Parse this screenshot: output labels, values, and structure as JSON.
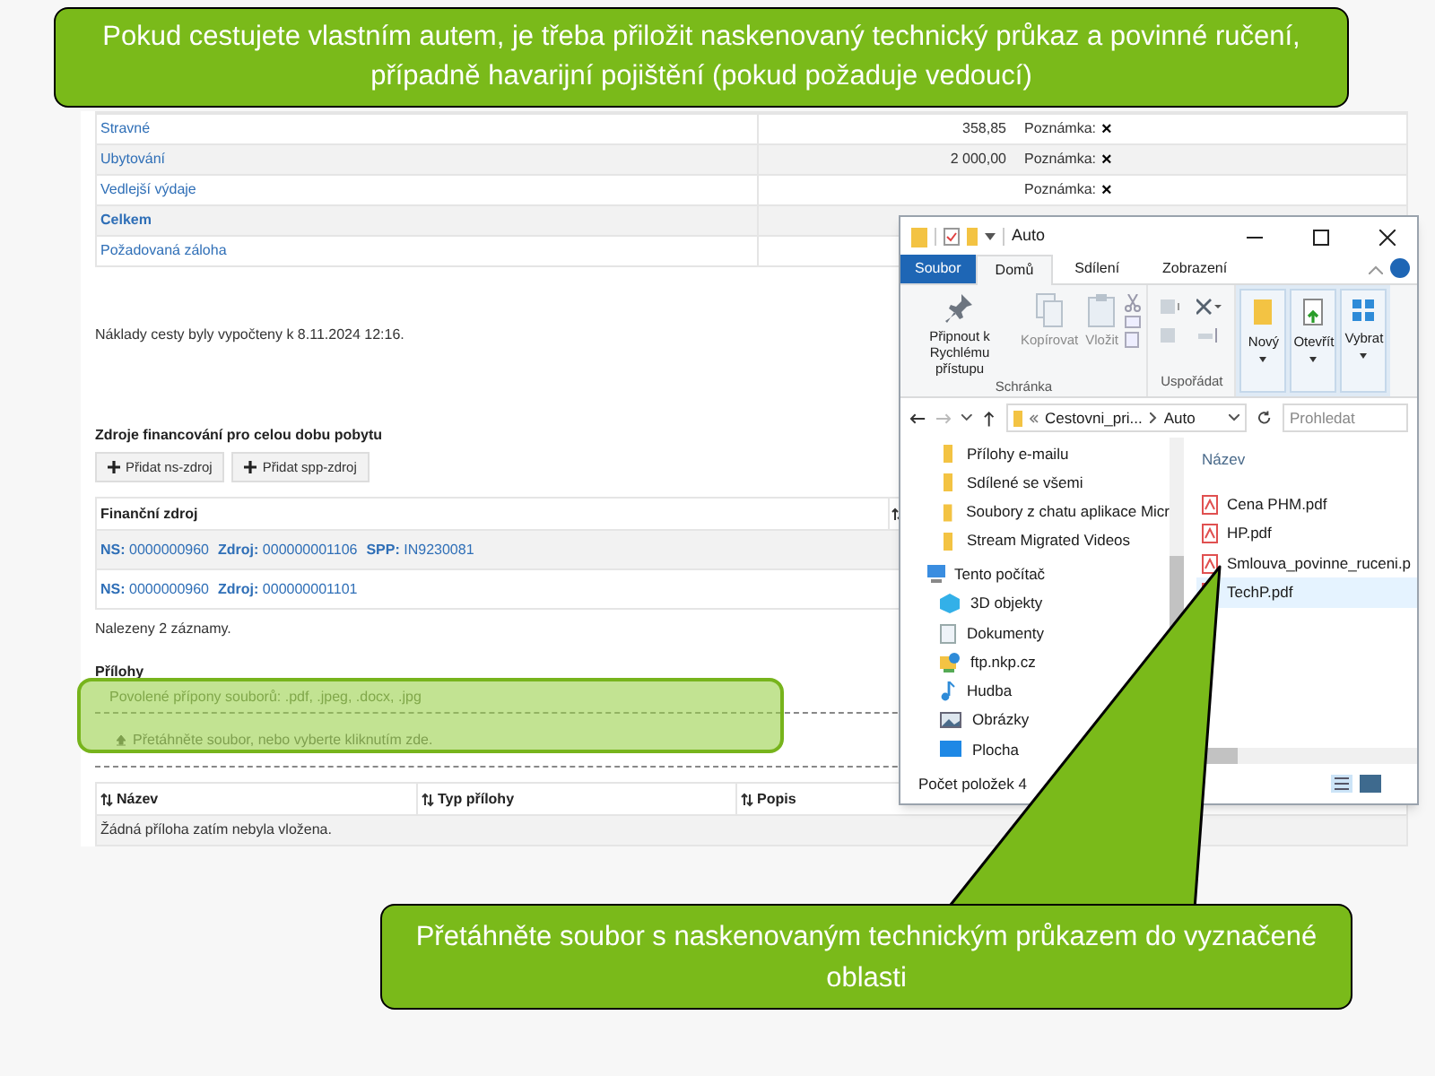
{
  "callout_top": {
    "text": "Pokud cestujete vlastním autem, je třeba přiložit naskenovaný technický průkaz a povinné ručení, případně havarijní pojištění (pokud požaduje vedoucí)"
  },
  "callout_bottom": {
    "text": "Přetáhněte soubor s naskenovaným technickým průkazem do vyznačené oblasti"
  },
  "costs": [
    {
      "label": "Stravné",
      "value": "358,85",
      "note": "Poznámka:",
      "mark": "×",
      "bold": false
    },
    {
      "label": "Ubytování",
      "value": "2 000,00",
      "note": "Poznámka:",
      "mark": "×",
      "bold": false
    },
    {
      "label": "Vedlejší výdaje",
      "note": "Poznámka:",
      "mark": "×",
      "bold": false
    },
    {
      "label": "Celkem",
      "bold": true
    },
    {
      "label": "Požadovaná záloha",
      "bold": false
    }
  ],
  "calc_note": "Náklady cesty byly vypočteny k 8.11.2024 12:16.",
  "financing": {
    "title": "Zdroje financování pro celou dobu pobytu",
    "buttons": [
      "Přidat ns-zdroj",
      "Přidat spp-zdroj"
    ],
    "column": "Finanční zdroj",
    "rows": [
      [
        {
          "label": "NS:",
          "value": "0000000960"
        },
        {
          "label": "Zdroj:",
          "value": "000000001106"
        },
        {
          "label": "SPP:",
          "value": "IN9230081"
        }
      ],
      [
        {
          "label": "NS:",
          "value": "0000000960"
        },
        {
          "label": "Zdroj:",
          "value": "000000001101"
        }
      ]
    ],
    "count": "Nalezeny 2 záznamy."
  },
  "attachments": {
    "title": "Přílohy",
    "allowed": "Povolené přípony souborů: .pdf, .jpeg, .docx, .jpg",
    "dropzone": "Přetáhněte soubor, nebo vyberte kliknutím zde.",
    "columns": [
      "Název",
      "Typ přílohy",
      "Popis"
    ],
    "empty": "Žádná příloha zatím nebyla vložena."
  },
  "explorer": {
    "title": "Auto",
    "tabs": [
      {
        "label": "Soubor",
        "kind": "file",
        "selected": false
      },
      {
        "label": "Domů",
        "kind": "tab",
        "selected": true
      },
      {
        "label": "Sdílení",
        "kind": "tab",
        "selected": false
      },
      {
        "label": "Zobrazení",
        "kind": "tab",
        "selected": false
      }
    ],
    "groups": [
      {
        "label": "Schránka",
        "commands": [
          {
            "label": "Připnout k Rychlému přístupu",
            "kind": "pin",
            "disabled": false
          },
          {
            "label": "Kopírovat",
            "kind": "copy",
            "disabled": true
          },
          {
            "label": "Vložit",
            "kind": "paste",
            "disabled": true
          }
        ]
      },
      {
        "label": "Uspořádat"
      }
    ],
    "big_commands": [
      {
        "label": "Nový",
        "kind": "new"
      },
      {
        "label": "Otevřít",
        "kind": "open"
      },
      {
        "label": "Vybrat",
        "kind": "select"
      }
    ],
    "path": [
      "Cestovni_pri...",
      "Auto"
    ],
    "search": {
      "placeholder": "Prohledat"
    },
    "nav": [
      {
        "label": "Přílohy e-mailu",
        "kind": "folder"
      },
      {
        "label": "Sdílené se všemi",
        "kind": "folder"
      },
      {
        "label": "Soubory z chatu aplikace Micr",
        "kind": "folder"
      },
      {
        "label": "Stream Migrated Videos",
        "kind": "folder"
      },
      {
        "label": "Tento počítač",
        "kind": "pc",
        "children": [
          {
            "label": "3D objekty",
            "kind": "cube"
          },
          {
            "label": "Dokumenty",
            "kind": "doc"
          },
          {
            "label": "ftp.nkp.cz",
            "kind": "net"
          },
          {
            "label": "Hudba",
            "kind": "music"
          },
          {
            "label": "Obrázky",
            "kind": "picture"
          },
          {
            "label": "Plocha",
            "kind": "desktop"
          }
        ]
      }
    ],
    "column": "Název",
    "files": [
      {
        "name": "Cena PHM.pdf",
        "selected": false
      },
      {
        "name": "HP.pdf",
        "selected": false
      },
      {
        "name": "Smlouva_povinne_ruceni.p",
        "selected": false
      },
      {
        "name": "TechP.pdf",
        "selected": true
      }
    ],
    "status": "Počet položek 4"
  }
}
